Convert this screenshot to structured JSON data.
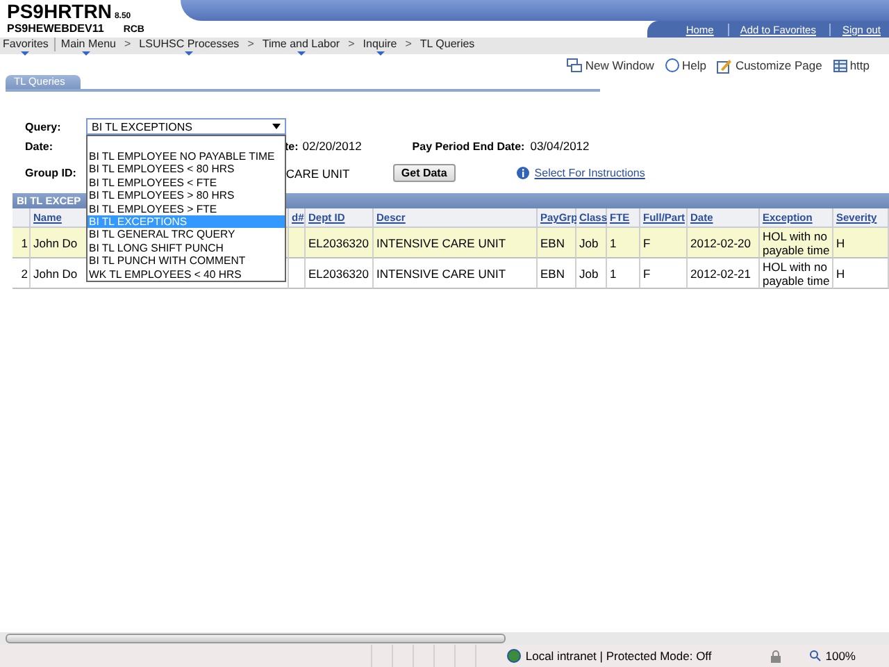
{
  "header": {
    "title": "PS9HRTRN",
    "version": "8.50",
    "server": "PS9HEWEBDEV11",
    "user": "RCB",
    "links": [
      "Home",
      "Add to Favorites",
      "Sign out"
    ]
  },
  "breadcrumbs": [
    {
      "label": "Favorites",
      "menu": true
    },
    {
      "label": "Main Menu",
      "menu": true,
      "divider": true
    },
    {
      "label": "LSUHSC Processes",
      "menu": true,
      "separator": ">"
    },
    {
      "label": "Time and Labor",
      "menu": true,
      "separator": ">"
    },
    {
      "label": "Inquire",
      "menu": true,
      "separator": ">"
    },
    {
      "label": "TL Queries",
      "menu": false,
      "separator": ">"
    }
  ],
  "toolbar": [
    "New Window",
    "Help",
    "Customize Page",
    "http"
  ],
  "page_tab": {
    "label": "TL Queries",
    "selected": true
  },
  "form": {
    "query_label": "Query:",
    "query_value": "BI TL EXCEPTIONS",
    "date_label": "Date:",
    "date_fragment": "te:",
    "date_value": "02/20/2012",
    "end_label": "Pay Period End Date:",
    "end_value": "03/04/2012",
    "group_label": "Group ID:",
    "group_fragment": "CARE UNIT",
    "button": "Get Data",
    "instructions_link": "Select For Instructions"
  },
  "dropdown": {
    "expanded": true,
    "options": [
      {
        "label": "BI TL EMPLOYEE NO PAYABLE TIME",
        "selected": false
      },
      {
        "label": "BI TL EMPLOYEES < 80 HRS",
        "selected": false
      },
      {
        "label": "BI TL EMPLOYEES < FTE",
        "selected": false
      },
      {
        "label": "BI TL EMPLOYEES > 80 HRS",
        "selected": false
      },
      {
        "label": "BI TL EMPLOYEES > FTE",
        "selected": false
      },
      {
        "label": "BI TL EXCEPTIONS",
        "selected": true
      },
      {
        "label": "BI TL GENERAL TRC QUERY",
        "selected": false
      },
      {
        "label": "BI TL LONG SHIFT PUNCH",
        "selected": false
      },
      {
        "label": "BI TL PUNCH WITH COMMENT",
        "selected": false
      },
      {
        "label": "WK TL EMPLOYEES < 40 HRS",
        "selected": false
      }
    ]
  },
  "grid": {
    "title": "BI TL EXCEP",
    "columns": [
      "Name",
      "d#",
      "Dept ID",
      "Descr",
      "PayGrp",
      "Class",
      "FTE",
      "Full/Part",
      "Date",
      "Exception",
      "Severity"
    ],
    "rows": [
      {
        "number": "1",
        "highlighted": true,
        "name": "John Do",
        "dept_id": "EL2036320",
        "descr": "INTENSIVE CARE UNIT",
        "pay_group": "EBN",
        "class": "Job",
        "fte": "1",
        "full_part": "F",
        "date": "2012-02-20",
        "exception": "HOL with no payable time",
        "severity": "H"
      },
      {
        "number": "2",
        "highlighted": false,
        "name": "John Do",
        "dept_id": "EL2036320",
        "descr": "INTENSIVE CARE UNIT",
        "pay_group": "EBN",
        "class": "Job",
        "fte": "1",
        "full_part": "F",
        "date": "2012-02-21",
        "exception": "HOL with no payable time",
        "severity": "H"
      }
    ]
  },
  "status_bar": {
    "zone": "Local intranet | Protected Mode: Off",
    "zoom": "100%"
  }
}
